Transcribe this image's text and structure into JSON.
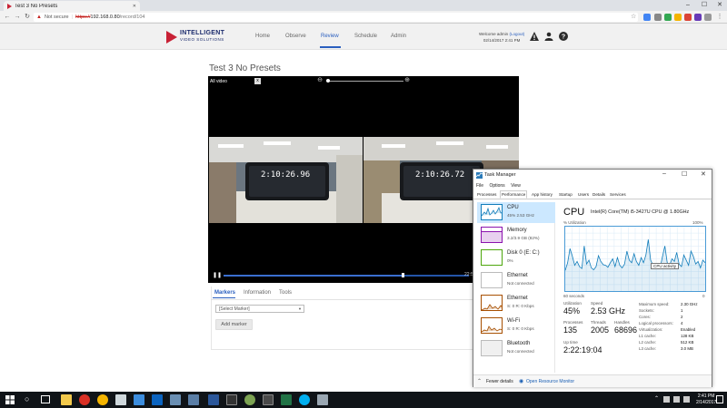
{
  "browser": {
    "tab_title": "Test 3 No Presets",
    "not_secure": "Not secure",
    "url_scheme": "https://",
    "url_host": "192.168.0.80",
    "url_path": "/record/104",
    "controls": {
      "minimize": "–",
      "maximize": "☐",
      "close": "✕"
    }
  },
  "app": {
    "brand_line1": "INTELLIGENT",
    "brand_line2": "VIDEO SOLUTIONS",
    "nav": [
      {
        "label": "Home"
      },
      {
        "label": "Observe"
      },
      {
        "label": "Review",
        "active": true
      },
      {
        "label": "Schedule"
      },
      {
        "label": "Admin"
      }
    ],
    "welcome": "Welcome admin",
    "logout": "(Logout)",
    "datetime": "02/14/2017 2:41 PM",
    "accent": "#2a5fbf",
    "brand_red": "#c82135"
  },
  "page": {
    "title": "Test 3 No Presets"
  },
  "video": {
    "label": "All video",
    "close": "x",
    "cam1_time": "2:10:26.96",
    "cam2_time": "2:10:26.72",
    "elapsed": "22:5",
    "progress": 0.73
  },
  "panel": {
    "tabs": [
      {
        "label": "Markers",
        "active": true
      },
      {
        "label": "Information"
      },
      {
        "label": "Tools"
      }
    ],
    "select_placeholder": "[Select Marker]",
    "add_button": "Add marker"
  },
  "task_manager": {
    "title": "Task Manager",
    "menu": [
      "File",
      "Options",
      "View"
    ],
    "tabs": [
      "Processes",
      "Performance",
      "App history",
      "Startup",
      "Users",
      "Details",
      "Services"
    ],
    "active_tab": "Performance",
    "resources": [
      {
        "name": "CPU",
        "detail": "45% 2.53 GHz",
        "color": "#117dbb"
      },
      {
        "name": "Memory",
        "detail": "3.2/3.9 GB (82%)",
        "color": "#8b12ae"
      },
      {
        "name": "Disk 0 (E: C:)",
        "detail": "0%",
        "color": "#4da60c"
      },
      {
        "name": "Ethernet",
        "detail": "Not connected",
        "color": "#a74f01"
      },
      {
        "name": "Ethernet",
        "detail": "S: 0 R: 0 Kbps",
        "color": "#a74f01"
      },
      {
        "name": "Wi-Fi",
        "detail": "S: 0 R: 0 Kbps",
        "color": "#a74f01"
      },
      {
        "name": "Bluetooth",
        "detail": "Not connected",
        "color": "#a74f01"
      }
    ],
    "cpu_heading": "CPU",
    "cpu_model": "Intel(R) Core(TM) i5-3427U CPU @ 1.80GHz",
    "util_label": "% Utilization",
    "util_max": "100%",
    "graph_left": "60 seconds",
    "graph_right": "0",
    "tooltip": "CPU activity",
    "stats": {
      "utilization_label": "Utilization",
      "utilization": "45%",
      "speed_label": "Speed",
      "speed": "2.53 GHz",
      "processes_label": "Processes",
      "processes": "135",
      "threads_label": "Threads",
      "threads": "2005",
      "handles_label": "Handles",
      "handles": "68696",
      "uptime_label": "Up time",
      "uptime": "2:22:19:04"
    },
    "specs": [
      {
        "label": "Maximum speed:",
        "value": "2.30 GHz"
      },
      {
        "label": "Sockets:",
        "value": "1"
      },
      {
        "label": "Cores:",
        "value": "2"
      },
      {
        "label": "Logical processors:",
        "value": "4"
      },
      {
        "label": "Virtualization:",
        "value": "Enabled"
      },
      {
        "label": "L1 cache:",
        "value": "128 KB"
      },
      {
        "label": "L2 cache:",
        "value": "512 KB"
      },
      {
        "label": "L3 cache:",
        "value": "3.0 MB"
      }
    ],
    "cpu_history": [
      32,
      44,
      66,
      54,
      40,
      46,
      38,
      35,
      70,
      42,
      48,
      36,
      33,
      38,
      55,
      46,
      41,
      40,
      37,
      44,
      50,
      38,
      52,
      40,
      36,
      42,
      62,
      48,
      44,
      58,
      46,
      40,
      52,
      44,
      56,
      80,
      48,
      40,
      38,
      42,
      36,
      54,
      70,
      44,
      40,
      50,
      46,
      60,
      42,
      38,
      56,
      48,
      40,
      62,
      54,
      42,
      46,
      36,
      48,
      44
    ],
    "fewer_details": "Fewer details",
    "resource_monitor": "Open Resource Monitor"
  },
  "taskbar": {
    "time": "2:41 PM",
    "date": "2/14/2017"
  }
}
